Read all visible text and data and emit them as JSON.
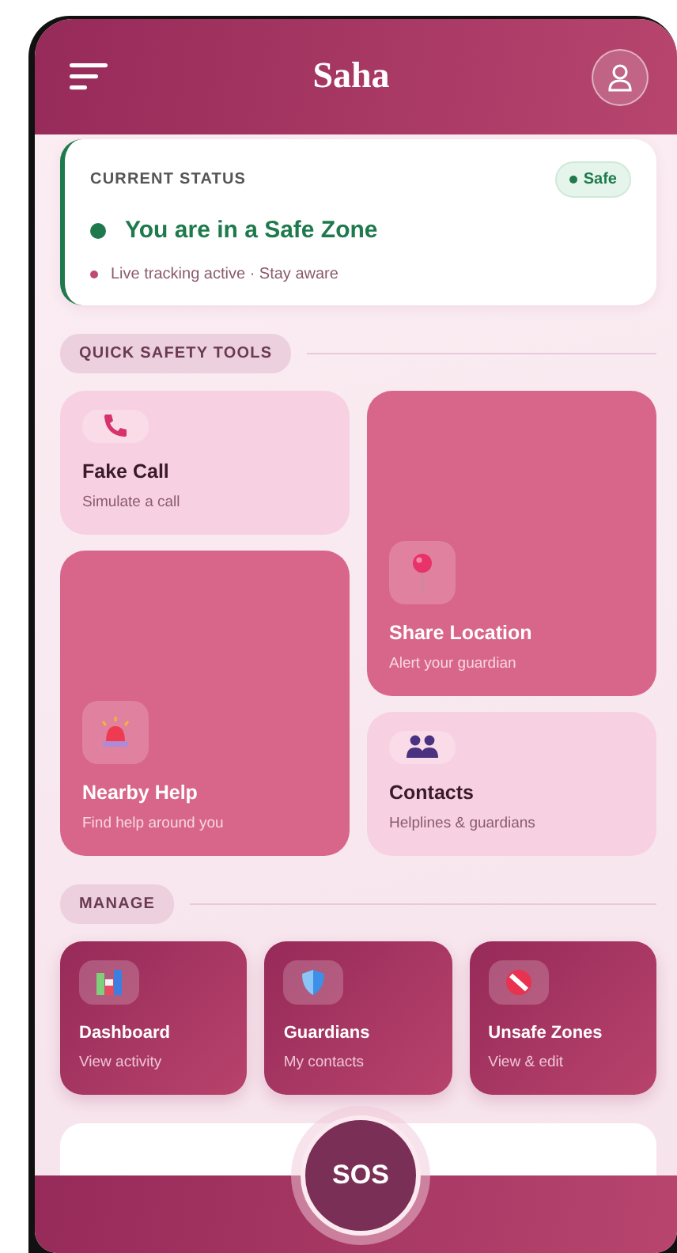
{
  "header": {
    "title": "Saha"
  },
  "status": {
    "label": "CURRENT STATUS",
    "badge": "Safe",
    "headline": "You are in a Safe Zone",
    "note": "Live tracking active · Stay aware",
    "color": "#1e7a4c"
  },
  "quick_tools": {
    "heading": "QUICK SAFETY TOOLS",
    "items": [
      {
        "title": "Fake Call",
        "subtitle": "Simulate a call",
        "kind": "light"
      },
      {
        "title": "Share Location",
        "subtitle": "Alert your guardian",
        "kind": "dark"
      },
      {
        "title": "Nearby Help",
        "subtitle": "Find help around you",
        "kind": "dark"
      },
      {
        "title": "Contacts",
        "subtitle": "Helplines & guardians",
        "kind": "light"
      }
    ]
  },
  "manage": {
    "heading": "MANAGE",
    "items": [
      {
        "title": "Dashboard",
        "subtitle": "View activity"
      },
      {
        "title": "Guardians",
        "subtitle": "My contacts"
      },
      {
        "title": "Unsafe Zones",
        "subtitle": "View & edit"
      }
    ]
  },
  "sos_button": {
    "label": "SOS"
  }
}
